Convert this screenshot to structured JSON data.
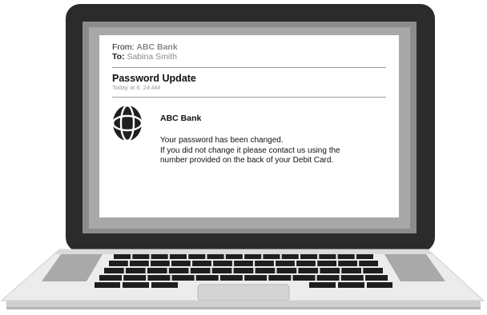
{
  "email": {
    "from_label": "From:",
    "from_value": "ABC Bank",
    "to_label": "To:",
    "to_value": "Sabina Smith",
    "subject": "Password Update",
    "timestamp": "Today at 6: 24 AM",
    "sender_name": "ABC Bank",
    "logo_icon": "globe-icon",
    "body_lines": [
      "Your password has been changed.",
      "If you did not change it please contact us using the",
      "number provided on the back of your Debit Card."
    ]
  },
  "colors": {
    "bezel": "#2b2b2b",
    "screen_frame": "#8c8c8c",
    "deck": "#ececec",
    "keys": "#1e1e1e"
  }
}
